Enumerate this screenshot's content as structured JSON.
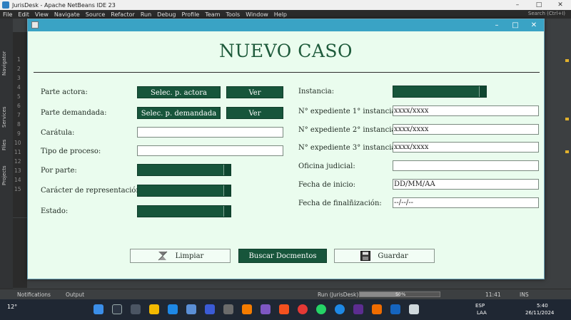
{
  "ide": {
    "title": "JurisDesk - Apache NetBeans IDE 23",
    "menu": [
      "File",
      "Edit",
      "View",
      "Navigate",
      "Source",
      "Refactor",
      "Run",
      "Debug",
      "Profile",
      "Team",
      "Tools",
      "Window",
      "Help"
    ],
    "search_placeholder": "Search (Ctrl+I)",
    "rail_tabs": [
      "Navigator",
      "Services",
      "Files",
      "Projects"
    ],
    "line_numbers": [
      "1",
      "2",
      "3",
      "4",
      "5",
      "6",
      "7",
      "8",
      "9",
      "10",
      "11",
      "12",
      "13",
      "14",
      "15"
    ],
    "status": {
      "notifications": "Notifications",
      "output": "Output",
      "run_label": "Run (JurisDesk)",
      "progress_percent": 50,
      "progress_text": "50%",
      "position": "11:41",
      "mode": "INS"
    }
  },
  "taskbar": {
    "weather": "12°",
    "language": "ESP",
    "layout": "LAA",
    "time": "5:40",
    "date": "26/11/2024"
  },
  "dialog": {
    "heading": "NUEVO CASO",
    "left": {
      "parte_actora": {
        "label": "Parte actora:",
        "select_button": "Selec. p. actora",
        "view_button": "Ver"
      },
      "parte_demandada": {
        "label": "Parte demandada:",
        "select_button": "Selec. p. demandada",
        "view_button": "Ver"
      },
      "caratula": {
        "label": "Carátula:",
        "value": ""
      },
      "tipo_proceso": {
        "label": "Tipo de proceso:",
        "value": ""
      },
      "por_parte": {
        "label": "Por parte:"
      },
      "caracter": {
        "label": "Carácter de representación:"
      },
      "estado": {
        "label": "Estado:"
      }
    },
    "right": {
      "instancia": {
        "label": "Instancia:"
      },
      "exp1": {
        "label": "N° expediente 1° instancia:",
        "value": "xxxx/xxxx"
      },
      "exp2": {
        "label": "N° expediente 2° instancia:",
        "value": "xxxx/xxxx"
      },
      "exp3": {
        "label": "N° expediente 3° instancia:",
        "value": "xxxx/xxxx"
      },
      "oficina": {
        "label": "Oficina judicial:",
        "value": ""
      },
      "fecha_inicio": {
        "label": "Fecha de inicio:",
        "value": "DD/MM/AA"
      },
      "fecha_fin": {
        "label": "Fecha de finalñización:",
        "value": "--/--/--"
      }
    },
    "buttons": {
      "limpiar": "Limpiar",
      "buscar": "Buscar Docmentos",
      "guardar": "Guardar"
    },
    "colors": {
      "accent": "#17553b",
      "background": "#eafcee",
      "titlebar": "#3aa3c5"
    }
  }
}
